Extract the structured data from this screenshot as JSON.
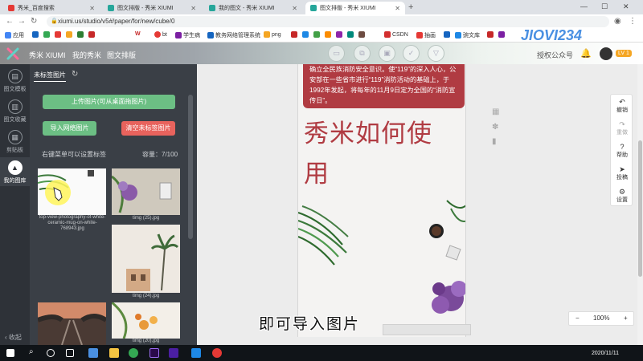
{
  "browser": {
    "tabs": [
      {
        "title": "秀米_百度搜索",
        "active": false
      },
      {
        "title": "图文排版 - 秀米 XIUMI",
        "active": false
      },
      {
        "title": "我的图文 - 秀米 XIUMI",
        "active": false
      },
      {
        "title": "图文排版 - 秀米 XIUMI",
        "active": true
      }
    ],
    "url": "xiumi.us/studio/v5#/paper/for/new/cube/0",
    "bookmarks": [
      "应用",
      "W",
      "bt",
      "学生病",
      "教务网络管理系统",
      "png",
      "CSDN",
      "抽画",
      "豌文库"
    ],
    "bookmark_colors": [
      "#4285f4",
      "#1565c0",
      "#34a853",
      "#e53935",
      "#f5a623",
      "#2e7d32",
      "#c62828",
      "#ef6c00",
      "#7b1fa2",
      "#d32f2f"
    ]
  },
  "watermark_logo": "JIOVI234",
  "header": {
    "brand": "秀米 XIUMI",
    "nav": [
      "我的秀米",
      "图文排版"
    ],
    "auth_link": "授权公众号",
    "level_badge": "LV 1"
  },
  "rail": {
    "items": [
      {
        "label": "图文模板",
        "icon": "template-icon"
      },
      {
        "label": "图文收藏",
        "icon": "favorite-icon"
      },
      {
        "label": "剪贴板",
        "icon": "clipboard-icon"
      },
      {
        "label": "我的图库",
        "icon": "gallery-icon",
        "active": true
      }
    ],
    "collapse_label": "收起"
  },
  "panel": {
    "tab_label": "未标签图片",
    "upload_button": "上传图片(可从桌面拖图片)",
    "import_button": "导入网络图片",
    "clear_button": "清空未标签图片",
    "hint": "右键菜单可以设置标签",
    "capacity": "容量：7/100",
    "images": [
      {
        "caption": "top-view-photography-of-white-ceramic-mug-on-white-768943.jpg"
      },
      {
        "caption": "timg (25).jpg"
      },
      {
        "caption": "timg (24).jpg"
      },
      {
        "caption": ""
      },
      {
        "caption": "timg (20).jpg"
      }
    ]
  },
  "canvas": {
    "notice_text": "确立全民族消防安全意识。使“119”的深入人心，公安部在一些省市进行“119”消防活动的基础上，于1992年发起，将每年的11月9日定为全国的“消防宣传日”。",
    "title": "秀米如何使用"
  },
  "toolbar": {
    "items": [
      {
        "label": "撤销",
        "icon": "undo-icon",
        "enabled": true
      },
      {
        "label": "重做",
        "icon": "redo-icon",
        "enabled": false
      },
      {
        "label": "帮助",
        "icon": "help-icon",
        "enabled": true
      },
      {
        "label": "投稿",
        "icon": "send-icon",
        "enabled": true
      },
      {
        "label": "设置",
        "icon": "settings-icon",
        "enabled": true
      }
    ]
  },
  "zoom": {
    "minus": "−",
    "level": "100%",
    "plus": "+"
  },
  "subtitle": "即可导入图片",
  "taskbar": {
    "date": "2020/11/11"
  },
  "colors": {
    "accent_red": "#b03b42",
    "green_button": "#6cbf84",
    "red_button": "#e8635d",
    "panel_bg": "#3a3f46",
    "rail_bg": "#2e3238"
  }
}
